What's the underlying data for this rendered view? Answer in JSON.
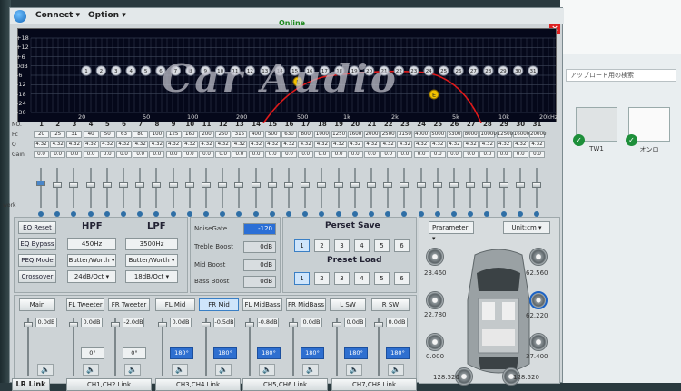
{
  "app": {
    "menu": [
      "Connect",
      "Option"
    ],
    "status": "Online",
    "close_label": "×"
  },
  "graph": {
    "watermark": "Car Audio",
    "y_labels": [
      "+18",
      "+12",
      "+6",
      "0dB",
      "-6",
      "-12",
      "-18",
      "-24",
      "-30"
    ],
    "freq_labels": [
      "20",
      "50",
      "100",
      "200",
      "500",
      "1k",
      "2k",
      "5k",
      "10k",
      "20kHz"
    ],
    "band_nodes": [
      "1",
      "2",
      "3",
      "4",
      "5",
      "6",
      "7",
      "8",
      "9",
      "10",
      "11",
      "12",
      "13",
      "14",
      "15",
      "16",
      "17",
      "18",
      "19",
      "20",
      "21",
      "22",
      "23",
      "24",
      "25",
      "26",
      "27",
      "28",
      "29",
      "30",
      "31"
    ],
    "markers": [
      "L",
      "E"
    ]
  },
  "bands": {
    "row_labels": {
      "no": "NO.",
      "fc": "Fc",
      "q": "Q",
      "gain": "Gain"
    },
    "numbers": [
      "1",
      "2",
      "3",
      "4",
      "5",
      "6",
      "7",
      "8",
      "9",
      "10",
      "11",
      "12",
      "13",
      "14",
      "15",
      "16",
      "17",
      "18",
      "19",
      "20",
      "21",
      "22",
      "23",
      "24",
      "25",
      "26",
      "27",
      "28",
      "29",
      "30",
      "31"
    ],
    "fc": [
      "20",
      "25",
      "31",
      "40",
      "50",
      "63",
      "80",
      "100",
      "125",
      "160",
      "200",
      "250",
      "315",
      "400",
      "500",
      "630",
      "800",
      "1000",
      "1250",
      "1600",
      "2000",
      "2500",
      "3150",
      "4000",
      "5000",
      "6300",
      "8000",
      "10000",
      "12500",
      "16000",
      "20000"
    ],
    "q": [
      "4.32",
      "4.32",
      "4.32",
      "4.32",
      "4.32",
      "4.32",
      "4.32",
      "4.32",
      "4.32",
      "4.32",
      "4.32",
      "4.32",
      "4.32",
      "4.32",
      "4.32",
      "4.32",
      "4.32",
      "4.32",
      "4.32",
      "4.32",
      "4.32",
      "4.32",
      "4.32",
      "4.32",
      "4.32",
      "4.32",
      "4.32",
      "4.32",
      "4.32",
      "4.32",
      "4.32"
    ],
    "gain": [
      "0.0",
      "0.0",
      "0.0",
      "0.0",
      "0.0",
      "0.0",
      "0.0",
      "0.0",
      "0.0",
      "0.0",
      "0.0",
      "0.0",
      "0.0",
      "0.0",
      "0.0",
      "0.0",
      "0.0",
      "0.0",
      "0.0",
      "0.0",
      "0.0",
      "0.0",
      "0.0",
      "0.0",
      "0.0",
      "0.0",
      "0.0",
      "0.0",
      "0.0",
      "0.0",
      "0.0"
    ],
    "work_label": "work"
  },
  "eq": {
    "reset": "EQ Reset",
    "bypass": "EQ Bypass",
    "peq_mode": "PEQ Mode",
    "crossover": "Crossover",
    "hpf_title": "HPF",
    "lpf_title": "LPF",
    "hpf_freq": "450Hz",
    "lpf_freq": "3500Hz",
    "hpf_type": "Butter/Worth",
    "lpf_type": "Butter/Worth",
    "hpf_slope": "24dB/Oct",
    "lpf_slope": "18dB/Oct"
  },
  "boost": {
    "noise_gate_label": "NoiseGate",
    "noise_gate": "-120",
    "treble_label": "Treble Boost",
    "treble": "0dB",
    "mid_label": "Mid Boost",
    "mid": "0dB",
    "bass_label": "Bass Boost",
    "bass": "0dB"
  },
  "presets": {
    "save_title": "Perset Save",
    "load_title": "Preset Load",
    "slots": [
      "1",
      "2",
      "3",
      "4",
      "5",
      "6"
    ]
  },
  "position": {
    "parameter": "Prarameter",
    "unit": "Unit:cm",
    "distances": [
      "23.460",
      "62.560",
      "22.780",
      "62.220",
      "0.000",
      "37.400",
      "128.520",
      "128.520"
    ]
  },
  "channels": {
    "tabs": [
      "Main",
      "FL Tweeter",
      "FR Tweeter",
      "FL Mid",
      "FR Mid",
      "FL MidBass",
      "FR MidBass",
      "L SW",
      "R SW"
    ],
    "gains": [
      "0.0dB",
      "0.0dB",
      "-2.0dB",
      "0.0dB",
      "-0.5dB",
      "-0.8dB",
      "0.0dB",
      "0.0dB",
      "0.0dB"
    ],
    "phases": [
      "0°",
      "0°",
      "180°",
      "180°",
      "180°",
      "180°",
      "180°",
      "180°"
    ],
    "links": [
      "LR Link",
      "CH1,CH2 Link",
      "CH3,CH4 Link",
      "CH5,CH6 Link",
      "CH7,CH8 Link"
    ]
  },
  "desktop": {
    "search": "アップロード用の検索",
    "files": [
      "TW1",
      "オンロ"
    ]
  },
  "colors": {
    "graph_bg": "#05081a",
    "curve": "#e01a1a",
    "accent": "#2e6fd0",
    "online": "#1f8a1f"
  }
}
